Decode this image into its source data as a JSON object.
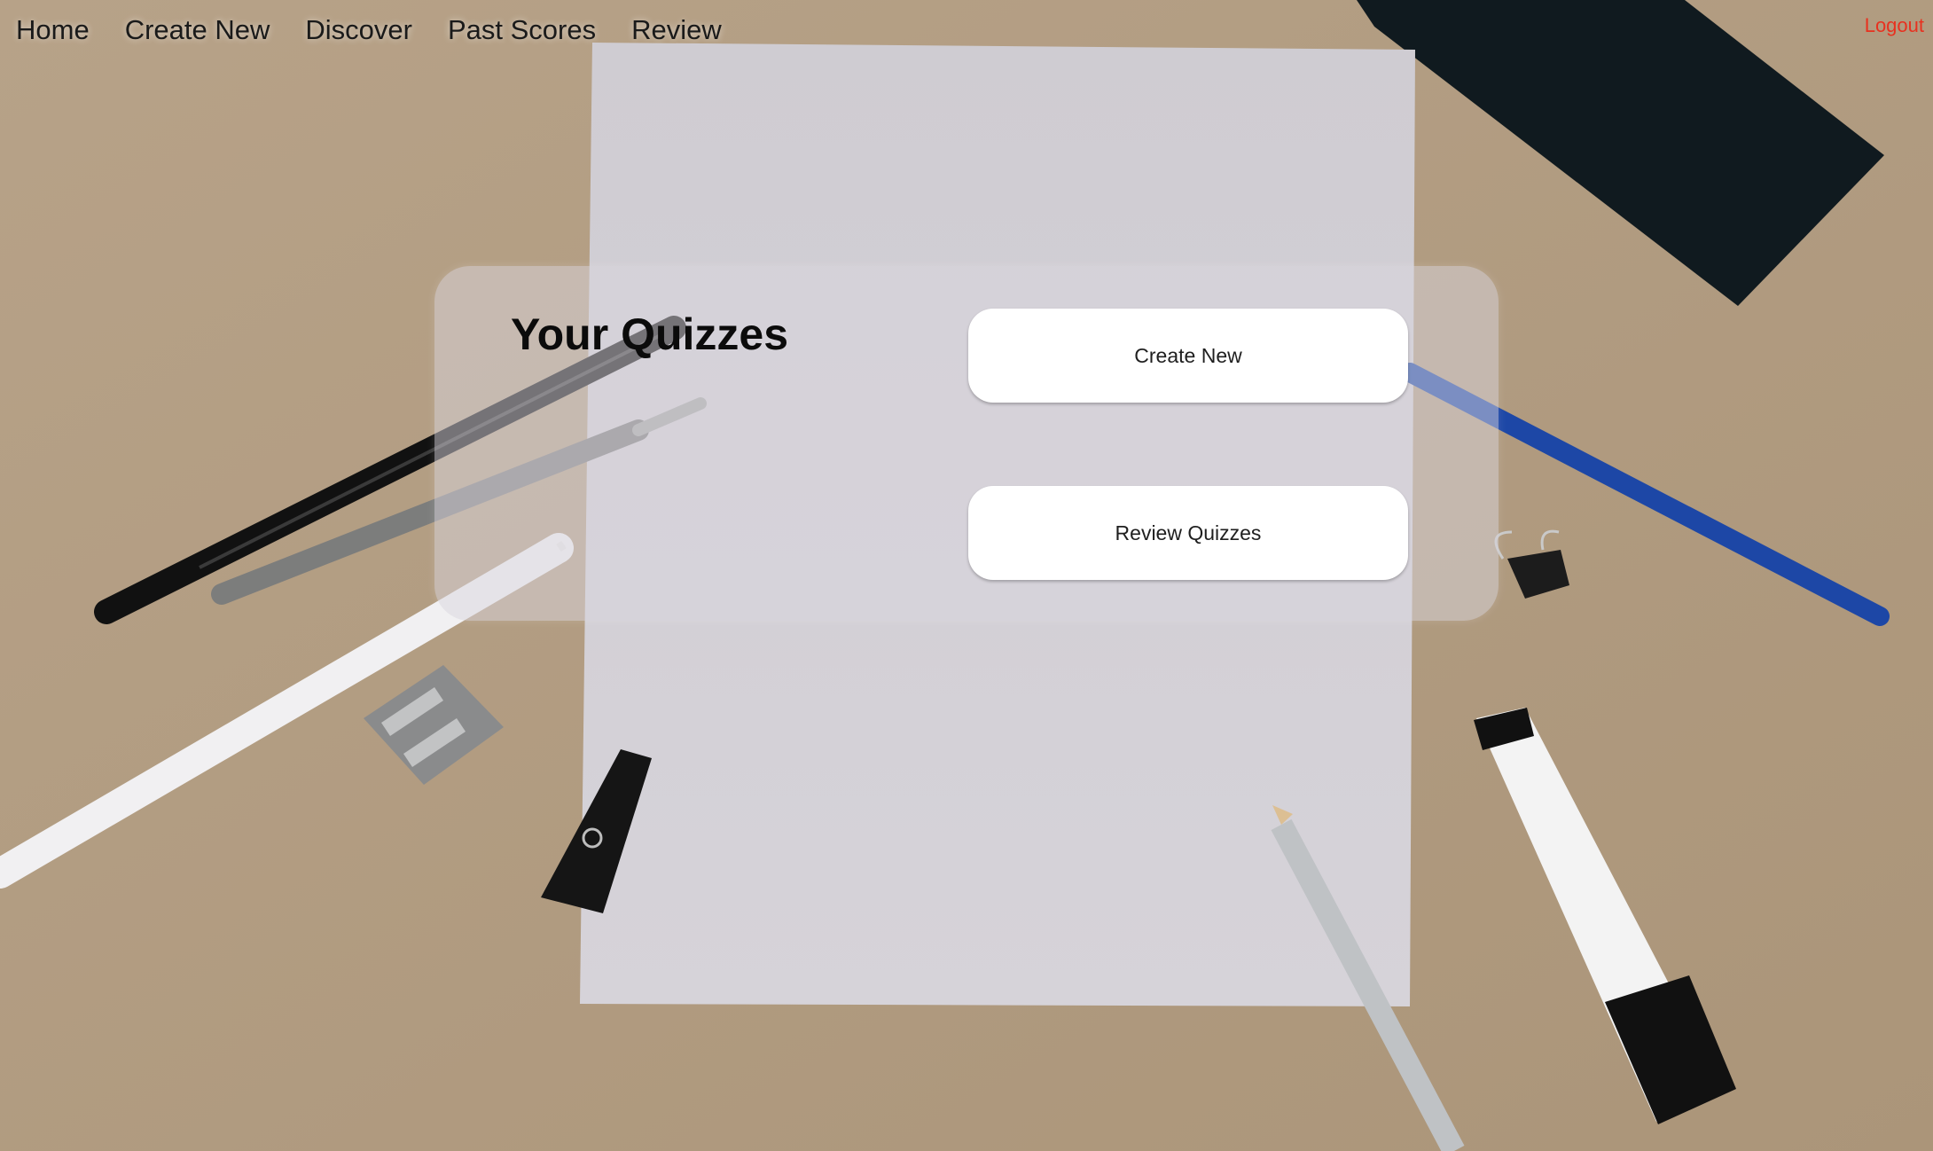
{
  "nav": {
    "items": [
      {
        "label": "Home"
      },
      {
        "label": "Create New"
      },
      {
        "label": "Discover"
      },
      {
        "label": "Past Scores"
      },
      {
        "label": "Review"
      }
    ],
    "logout_label": "Logout"
  },
  "main": {
    "title": "Your Quizzes",
    "buttons": {
      "create": "Create New",
      "review": "Review Quizzes"
    }
  },
  "background": {
    "description_icons": [
      "paper-sheet",
      "pens",
      "pencil",
      "sharpener",
      "binder-clip",
      "clothespin",
      "marker",
      "notebook"
    ]
  },
  "colors": {
    "logout": "#e8311f",
    "panel": "#dad6de",
    "background": "#b19c83"
  }
}
